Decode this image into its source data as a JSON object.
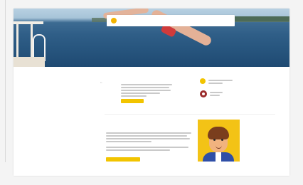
{
  "nav": {
    "logo_text": "",
    "items": [
      "",
      "",
      "",
      "",
      ""
    ]
  },
  "section1": {
    "title": "",
    "cta_label": ""
  },
  "sidebar": {
    "heading": ""
  },
  "section2": {
    "kicker": "",
    "title": "",
    "cta_label": ""
  },
  "colors": {
    "accent": "#f2c400",
    "avatar_bg": "#f3c316",
    "secondary_icon": "#9b2c2c"
  },
  "icons": {
    "logo": "sun-logo-icon",
    "sidebar_first": "yellow-circle-icon",
    "sidebar_second": "red-badge-icon",
    "illustration": "avatar-illustration"
  }
}
